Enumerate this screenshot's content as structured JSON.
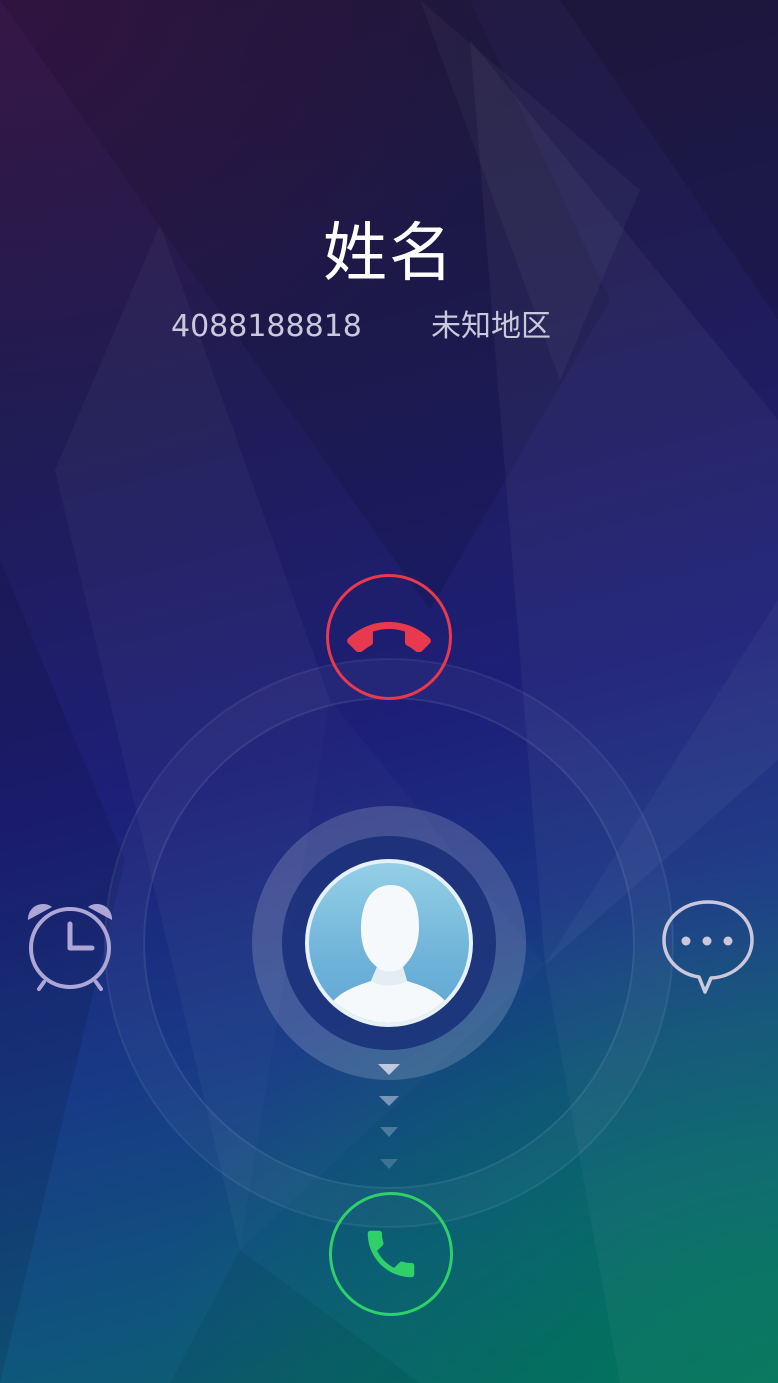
{
  "caller": {
    "name": "姓名",
    "number": "4088188818",
    "location": "未知地区"
  },
  "actions": {
    "decline": {
      "icon": "call-end-icon",
      "color": "#e8394f"
    },
    "answer": {
      "icon": "phone-icon",
      "color": "#2fd06a"
    },
    "remind": {
      "icon": "alarm-clock-icon",
      "color": "#aea7d6"
    },
    "message": {
      "icon": "message-bubble-icon",
      "color": "#cbc8dc"
    }
  },
  "slider": {
    "handle_icon": "contact-avatar-icon",
    "hint_icon": "chevron-down-icon"
  }
}
